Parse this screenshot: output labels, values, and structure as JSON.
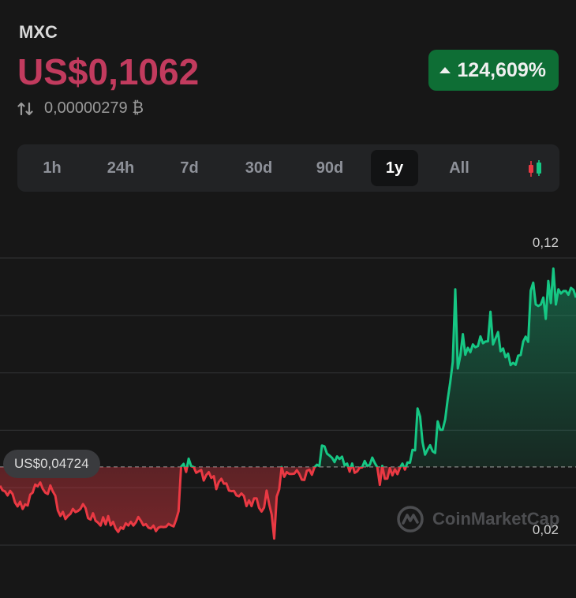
{
  "header": {
    "symbol": "MXC",
    "price": "US$0,1062",
    "change": "124,609%",
    "btc_price": "0,00000279 ₿"
  },
  "ranges": {
    "tabs": [
      "1h",
      "24h",
      "7d",
      "30d",
      "90d",
      "1y",
      "All"
    ],
    "active": "1y"
  },
  "chart_data": {
    "type": "line",
    "title": "",
    "xlabel": "",
    "ylabel": "",
    "ylim": [
      0.02,
      0.12
    ],
    "y_tick_labels": [
      "0,12",
      "0,02"
    ],
    "gridlines": [
      0.12,
      0.1,
      0.08,
      0.06,
      0.04,
      0.02
    ],
    "baseline": 0.04724,
    "baseline_label": "US$0,04724",
    "colors": {
      "above": "#16c784",
      "below": "#ea3943"
    },
    "series": [
      {
        "values": [
          0.0407,
          0.0391,
          0.0387,
          0.0373,
          0.0389,
          0.0378,
          0.0348,
          0.0335,
          0.0351,
          0.0326,
          0.0342,
          0.0338,
          0.0376,
          0.0383,
          0.0411,
          0.0405,
          0.0418,
          0.0396,
          0.0383,
          0.0378,
          0.0408,
          0.0387,
          0.0372,
          0.0321,
          0.0302,
          0.0316,
          0.0291,
          0.0302,
          0.0309,
          0.0326,
          0.0315,
          0.0319,
          0.0326,
          0.0343,
          0.0329,
          0.0294,
          0.0289,
          0.0311,
          0.0285,
          0.0278,
          0.0268,
          0.0297,
          0.0272,
          0.0301,
          0.0269,
          0.0281,
          0.0258,
          0.0246,
          0.0262,
          0.0257,
          0.0276,
          0.0268,
          0.0281,
          0.0268,
          0.0279,
          0.0298,
          0.0285,
          0.0269,
          0.0273,
          0.0261,
          0.0258,
          0.0268,
          0.0249,
          0.0261,
          0.0264,
          0.0263,
          0.0264,
          0.0274,
          0.0269,
          0.0265,
          0.0288,
          0.0318,
          0.0473,
          0.0483,
          0.0455,
          0.0501,
          0.0475,
          0.0472,
          0.0452,
          0.0457,
          0.0462,
          0.0425,
          0.0444,
          0.0454,
          0.0434,
          0.044,
          0.0395,
          0.042,
          0.0431,
          0.0414,
          0.0415,
          0.039,
          0.0388,
          0.0389,
          0.0373,
          0.037,
          0.038,
          0.0371,
          0.0336,
          0.0356,
          0.0336,
          0.0363,
          0.0363,
          0.033,
          0.0317,
          0.0331,
          0.039,
          0.0343,
          0.0307,
          0.0223,
          0.0369,
          0.0394,
          0.0472,
          0.0438,
          0.0454,
          0.0448,
          0.0448,
          0.0449,
          0.0461,
          0.0448,
          0.0428,
          0.0427,
          0.0459,
          0.0463,
          0.0445,
          0.0471,
          0.048,
          0.0475,
          0.0547,
          0.0544,
          0.0519,
          0.0512,
          0.0504,
          0.0489,
          0.0509,
          0.05,
          0.0508,
          0.0478,
          0.0484,
          0.0456,
          0.0484,
          0.0452,
          0.0457,
          0.047,
          0.0471,
          0.0493,
          0.0475,
          0.048,
          0.0505,
          0.0486,
          0.0471,
          0.041,
          0.0476,
          0.0431,
          0.0432,
          0.0468,
          0.0443,
          0.0464,
          0.0447,
          0.047,
          0.0484,
          0.0463,
          0.0488,
          0.0487,
          0.0532,
          0.053,
          0.0676,
          0.0648,
          0.0559,
          0.0515,
          0.0533,
          0.0548,
          0.0527,
          0.0521,
          0.0631,
          0.0602,
          0.0602,
          0.0638,
          0.0708,
          0.0767,
          0.0838,
          0.1091,
          0.0815,
          0.086,
          0.0935,
          0.0863,
          0.0887,
          0.0872,
          0.0899,
          0.0889,
          0.0893,
          0.0927,
          0.0903,
          0.0909,
          0.091,
          0.1013,
          0.0899,
          0.092,
          0.0942,
          0.0875,
          0.0885,
          0.0854,
          0.0867,
          0.0827,
          0.0835,
          0.0828,
          0.086,
          0.0862,
          0.0909,
          0.0926,
          0.0908,
          0.1086,
          0.1114,
          0.1038,
          0.1033,
          0.1038,
          0.1062,
          0.0988,
          0.112,
          0.1043,
          0.1163,
          0.1038,
          0.1091,
          0.1076,
          0.1085,
          0.1085,
          0.1072,
          0.1096,
          0.1089,
          0.1062
        ]
      }
    ]
  },
  "watermark": "CoinMarketCap"
}
